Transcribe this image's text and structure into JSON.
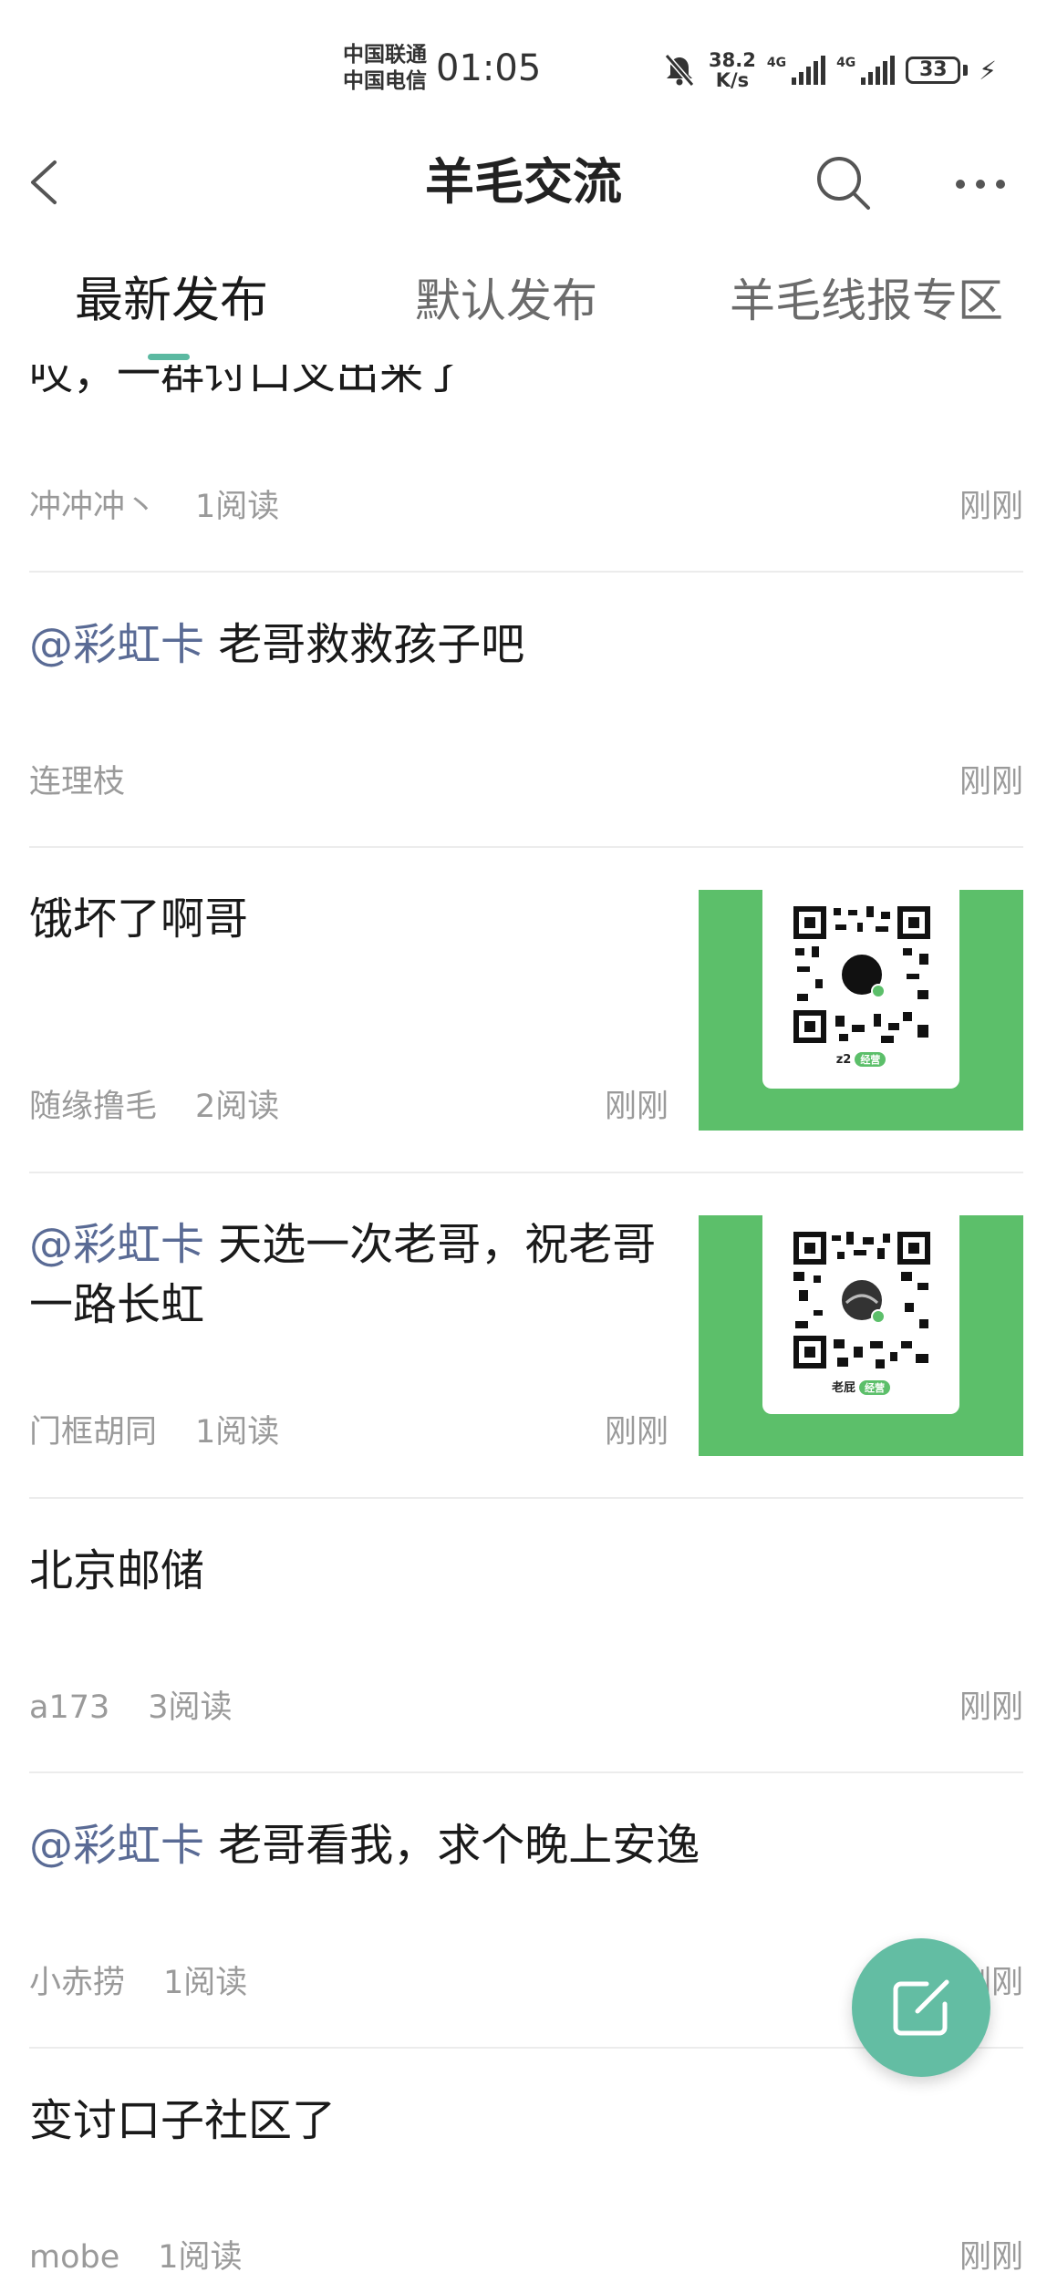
{
  "status_bar": {
    "carrier_1": "中国联通",
    "carrier_2": "中国电信",
    "time": "01:05",
    "speed_value": "38.2",
    "speed_unit": "K/s",
    "net_label_1": "4G",
    "net_label_2": "4G",
    "battery": "33"
  },
  "nav": {
    "title": "羊毛交流"
  },
  "tabs": [
    {
      "label": "最新发布",
      "active": true
    },
    {
      "label": "默认发布",
      "active": false
    },
    {
      "label": "羊毛线报专区",
      "active": false
    }
  ],
  "feed": {
    "partial_post": {
      "title": "哎，一群讨口叉出来了",
      "author": "冲冲冲丶",
      "reads": "1阅读",
      "time": "刚刚"
    },
    "posts": [
      {
        "mention": "@彩虹卡",
        "title": " 老哥救救孩子吧",
        "author": "连理枝",
        "reads": "",
        "time": "刚刚"
      },
      {
        "mention": "",
        "title": "饿坏了啊哥",
        "author": "随缘撸毛",
        "reads": "2阅读",
        "time": "刚刚",
        "thumb": {
          "name": "z2",
          "badge": "经营"
        }
      },
      {
        "mention": "@彩虹卡",
        "title": " 天选一次老哥，祝老哥一路长虹",
        "author": "门框胡同",
        "reads": "1阅读",
        "time": "刚刚",
        "thumb": {
          "name": "老屁",
          "badge": "经营"
        }
      },
      {
        "mention": "",
        "title": "北京邮储",
        "author": "a173",
        "reads": "3阅读",
        "time": "刚刚"
      },
      {
        "mention": "@彩虹卡",
        "title": " 老哥看我，求个晚上安逸",
        "author": "小赤捞",
        "reads": "1阅读",
        "time": "刚刚"
      },
      {
        "mention": "",
        "title": "变讨口子社区了",
        "author": "mobe",
        "reads": "1阅读",
        "time": "刚刚"
      }
    ]
  },
  "colors": {
    "accent": "#5bb9a1",
    "mention": "#5a6b95",
    "thumb_green": "#5cbf6a",
    "fab": "#63bda3",
    "meta_text": "#9a9a9a"
  },
  "icons": [
    "back-icon",
    "search-icon",
    "more-icon",
    "mute-icon",
    "signal-icon",
    "battery-icon",
    "charging-icon",
    "compose-icon",
    "qr-code-icon"
  ]
}
